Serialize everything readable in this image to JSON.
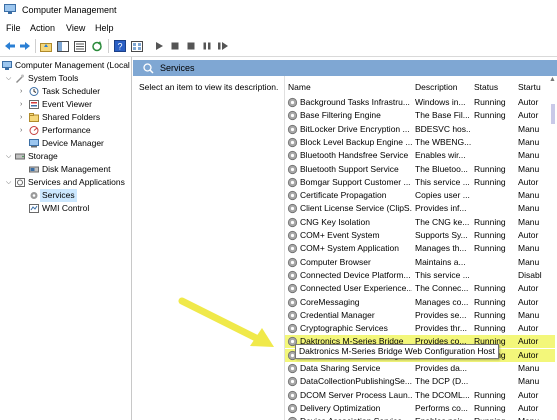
{
  "window": {
    "title": "Computer Management"
  },
  "menu": {
    "file": "File",
    "action": "Action",
    "view": "View",
    "help": "Help"
  },
  "tree": {
    "root": "Computer Management (Local",
    "system_tools": "System Tools",
    "task_scheduler": "Task Scheduler",
    "event_viewer": "Event Viewer",
    "shared_folders": "Shared Folders",
    "performance": "Performance",
    "device_manager": "Device Manager",
    "storage": "Storage",
    "disk_management": "Disk Management",
    "services_apps": "Services and Applications",
    "services": "Services",
    "wmi_control": "WMI Control"
  },
  "content": {
    "header_title": "Services",
    "placeholder": "Select an item to view its description."
  },
  "columns": {
    "name": "Name",
    "description": "Description",
    "status": "Status",
    "startup": "Startu"
  },
  "services": [
    {
      "name": "Background Tasks Infrastru...",
      "desc": "Windows in...",
      "status": "Running",
      "startup": "Autor"
    },
    {
      "name": "Base Filtering Engine",
      "desc": "The Base Fil...",
      "status": "Running",
      "startup": "Autor"
    },
    {
      "name": "BitLocker Drive Encryption ...",
      "desc": "BDESVC hos...",
      "status": "",
      "startup": "Manu"
    },
    {
      "name": "Block Level Backup Engine ...",
      "desc": "The WBENG...",
      "status": "",
      "startup": "Manu"
    },
    {
      "name": "Bluetooth Handsfree Service",
      "desc": "Enables wir...",
      "status": "",
      "startup": "Manu"
    },
    {
      "name": "Bluetooth Support Service",
      "desc": "The Bluetoo...",
      "status": "Running",
      "startup": "Manu"
    },
    {
      "name": "Bomgar Support Customer ...",
      "desc": "This service ...",
      "status": "Running",
      "startup": "Autor"
    },
    {
      "name": "Certificate Propagation",
      "desc": "Copies user ...",
      "status": "",
      "startup": "Manu"
    },
    {
      "name": "Client License Service (ClipS...",
      "desc": "Provides inf...",
      "status": "",
      "startup": "Manu"
    },
    {
      "name": "CNG Key Isolation",
      "desc": "The CNG ke...",
      "status": "Running",
      "startup": "Manu"
    },
    {
      "name": "COM+ Event System",
      "desc": "Supports Sy...",
      "status": "Running",
      "startup": "Autor"
    },
    {
      "name": "COM+ System Application",
      "desc": "Manages th...",
      "status": "Running",
      "startup": "Manu"
    },
    {
      "name": "Computer Browser",
      "desc": "Maintains a...",
      "status": "",
      "startup": "Manu"
    },
    {
      "name": "Connected Device Platform...",
      "desc": "This service ...",
      "status": "",
      "startup": "Disabl"
    },
    {
      "name": "Connected User Experience...",
      "desc": "The Connec...",
      "status": "Running",
      "startup": "Autor"
    },
    {
      "name": "CoreMessaging",
      "desc": "Manages co...",
      "status": "Running",
      "startup": "Autor"
    },
    {
      "name": "Credential Manager",
      "desc": "Provides se...",
      "status": "Running",
      "startup": "Manu"
    },
    {
      "name": "Cryptographic Services",
      "desc": "Provides thr...",
      "status": "Running",
      "startup": "Autor"
    },
    {
      "name": "Daktronics M-Series Bridge",
      "desc": "Provides co...",
      "status": "Running",
      "startup": "Autor"
    },
    {
      "name": "Daktronics M-Series Bridge ...",
      "desc": "Provides co...",
      "status": "Running",
      "startup": "Autor"
    },
    {
      "name": "Data Sharing Service",
      "desc": "Provides da...",
      "status": "",
      "startup": "Manu"
    },
    {
      "name": "DataCollectionPublishingSe...",
      "desc": "The DCP (D...",
      "status": "",
      "startup": "Manu"
    },
    {
      "name": "DCOM Server Process Laun...",
      "desc": "The DCOML...",
      "status": "Running",
      "startup": "Autor"
    },
    {
      "name": "Delivery Optimization",
      "desc": "Performs co...",
      "status": "Running",
      "startup": "Autor"
    },
    {
      "name": "Device Association Service",
      "desc": "Enables pair...",
      "status": "Running",
      "startup": "Manu"
    }
  ],
  "tooltip": "Daktronics M-Series Bridge Web Configuration Host",
  "colors": {
    "highlight": "#f3f77a",
    "header_bar": "#7fa7d3",
    "arrow": "#f0e94a",
    "selection": "#cce8ff"
  }
}
